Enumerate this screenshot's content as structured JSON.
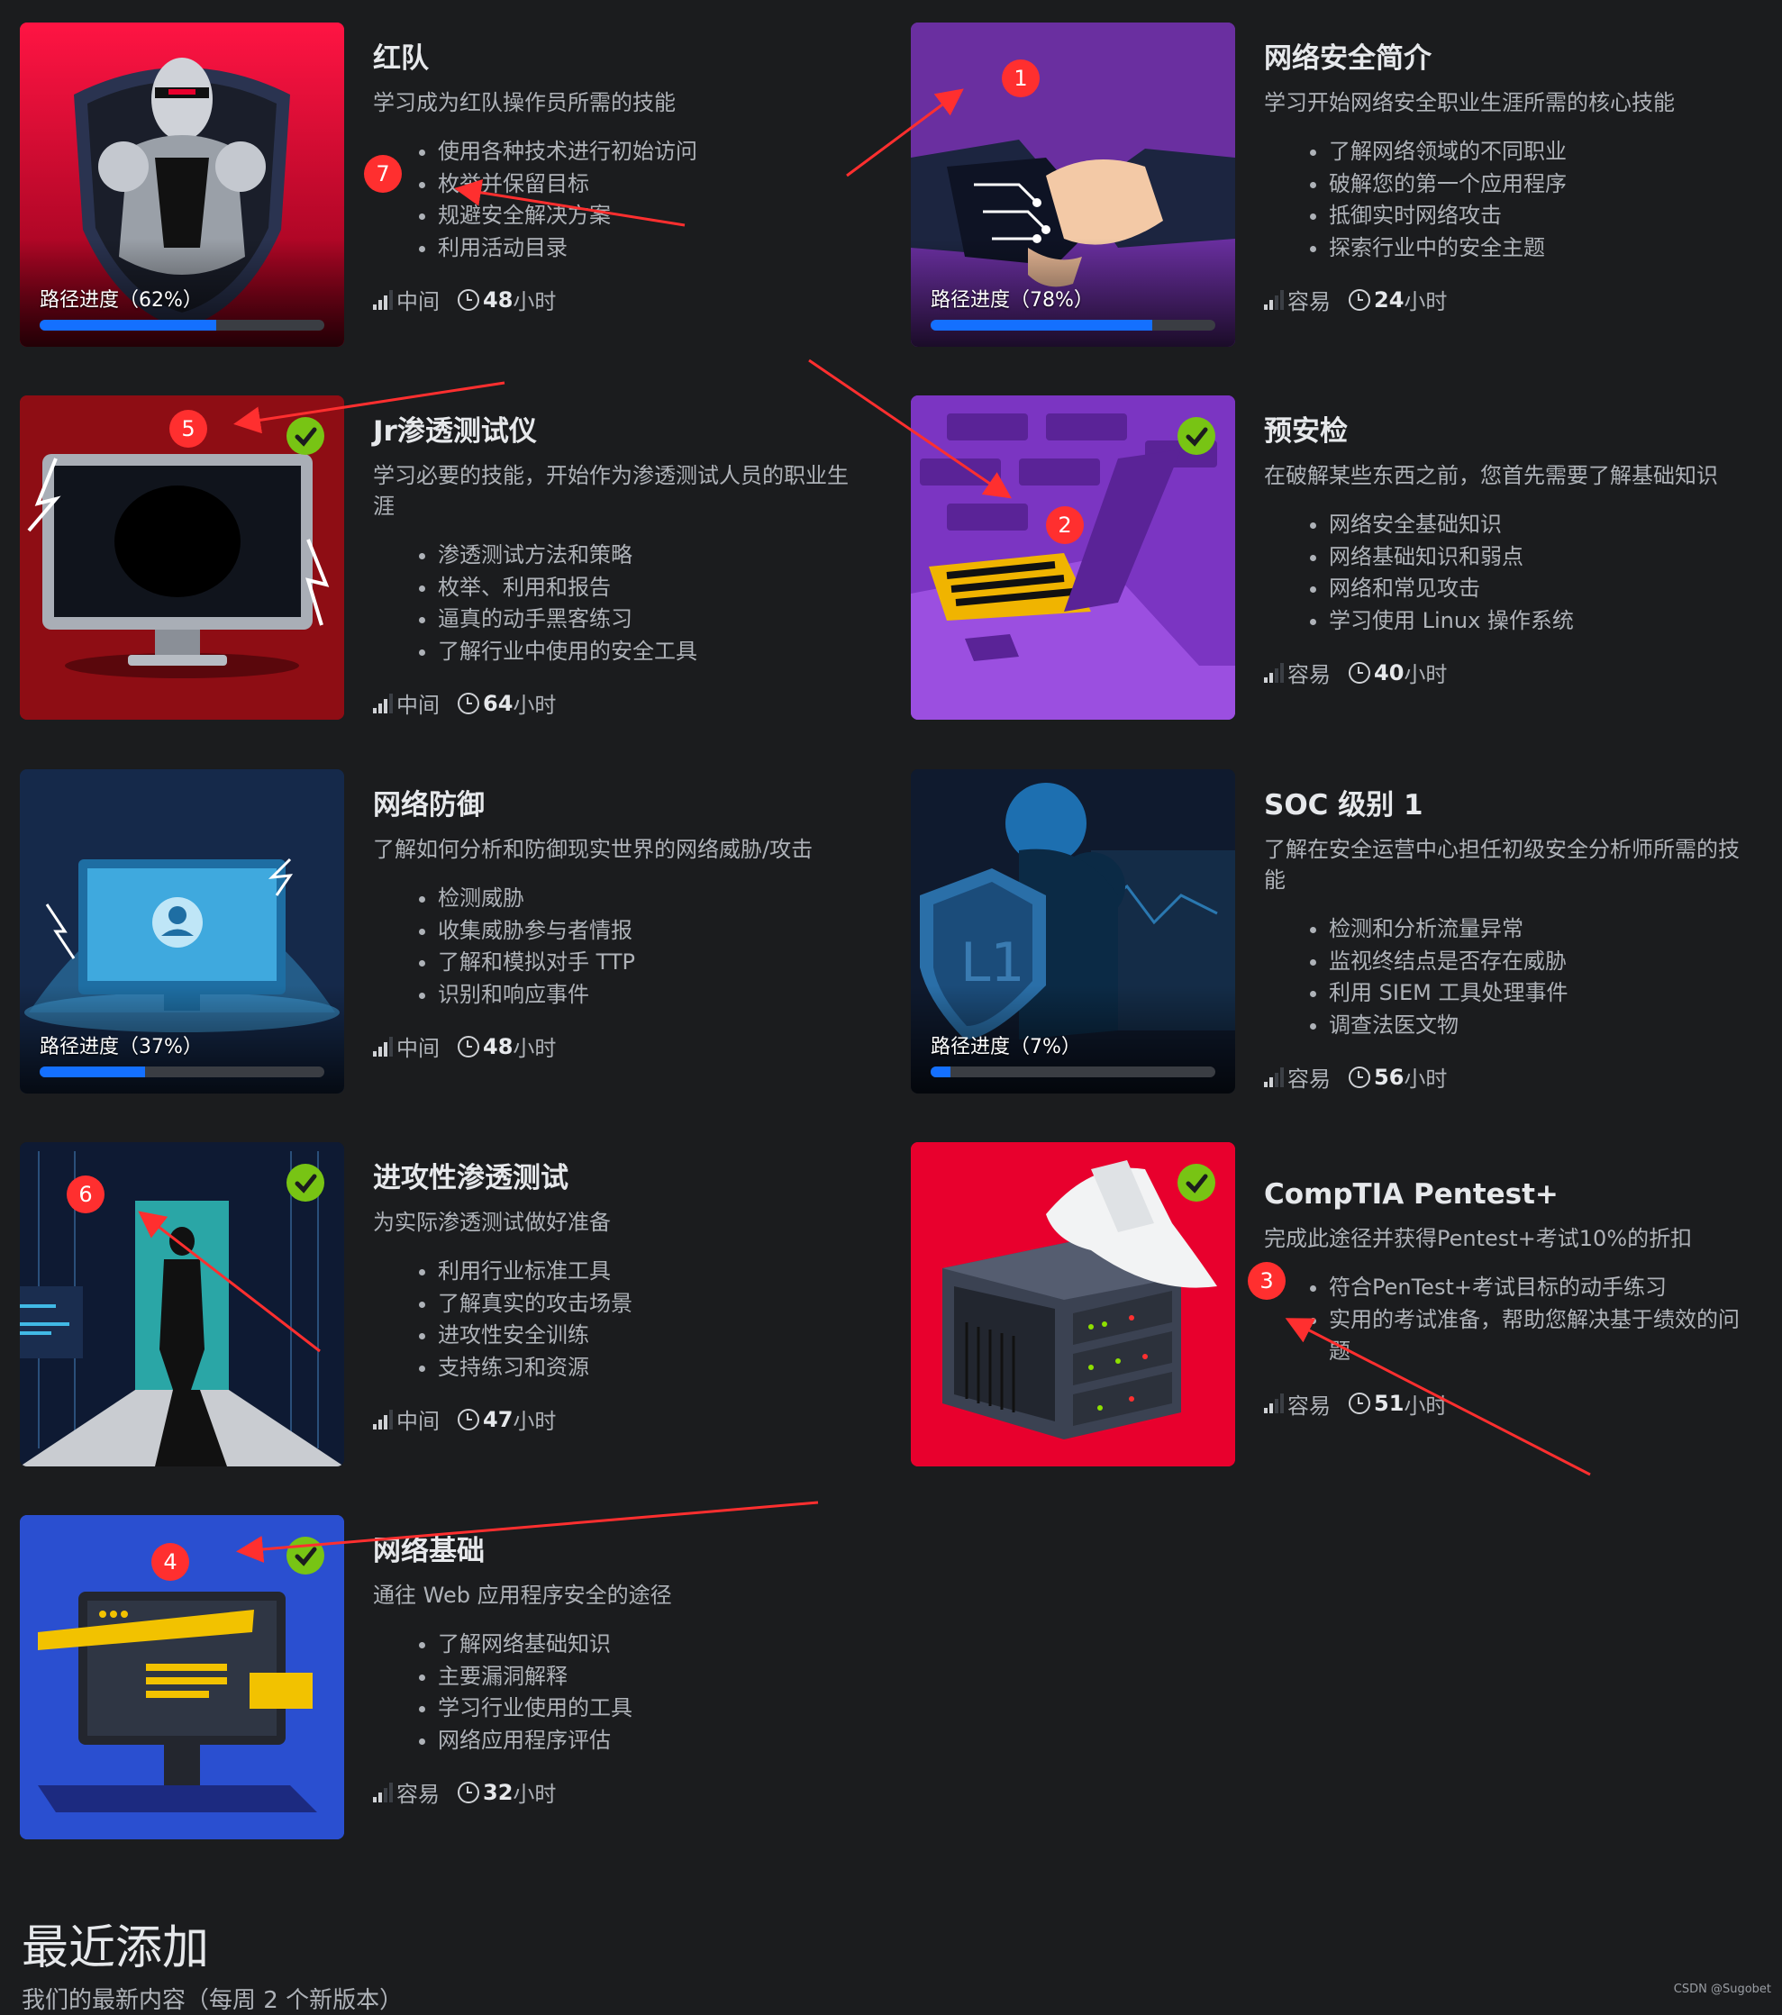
{
  "cards": [
    {
      "title": "红队",
      "desc": "学习成为红队操作员所需的技能",
      "bullets": [
        "使用各种技术进行初始访问",
        "枚举并保留目标",
        "规避安全解决方案",
        "利用活动目录"
      ],
      "difficulty": "中间",
      "hours": "48",
      "hours_unit": "小时",
      "progress_label": "路径进度（62%）",
      "progress": 62,
      "completed": false,
      "image": "knight-shield-illustration",
      "color": "#e8002d"
    },
    {
      "title": "网络安全简介",
      "desc": "学习开始网络安全职业生涯所需的核心技能",
      "bullets": [
        "了解网络领域的不同职业",
        "破解您的第一个应用程序",
        "抵御实时网络攻击",
        "探索行业中的安全主题"
      ],
      "difficulty": "容易",
      "hours": "24",
      "hours_unit": "小时",
      "progress_label": "路径进度（78%）",
      "progress": 78,
      "completed": false,
      "image": "circuit-handshake-illustration",
      "color": "#6a2fa0"
    },
    {
      "title": "Jr渗透测试仪",
      "desc": "学习必要的技能，开始作为渗透测试人员的职业生涯",
      "bullets": [
        "渗透测试方法和策略",
        "枚举、利用和报告",
        "逼真的动手黑客练习",
        "了解行业中使用的安全工具"
      ],
      "difficulty": "中间",
      "hours": "64",
      "hours_unit": "小时",
      "completed": true,
      "image": "monitor-lightning-illustration",
      "color": "#8e0d14"
    },
    {
      "title": "预安检",
      "desc": "在破解某些东西之前，您首先需要了解基础知识",
      "bullets": [
        "网络安全基础知识",
        "网络基础知识和弱点",
        "网络和常见攻击",
        "学习使用 Linux 操作系统"
      ],
      "difficulty": "容易",
      "hours": "40",
      "hours_unit": "小时",
      "completed": true,
      "image": "keyboard-enter-key-illustration",
      "color": "#7b35c2"
    },
    {
      "title": "网络防御",
      "desc": "了解如何分析和防御现实世界的网络威胁/攻击",
      "bullets": [
        "检测威胁",
        "收集威胁参与者情报",
        "了解和模拟对手 TTP",
        "识别和响应事件"
      ],
      "difficulty": "中间",
      "hours": "48",
      "hours_unit": "小时",
      "progress_label": "路径进度（37%）",
      "progress": 37,
      "completed": false,
      "image": "shielded-computer-illustration",
      "color": "#15294a"
    },
    {
      "title": "SOC 级别 1",
      "desc": "了解在安全运营中心担任初级安全分析师所需的技能",
      "bullets": [
        "检测和分析流量异常",
        "监视终结点是否存在威胁",
        "利用 SIEM 工具处理事件",
        "调查法医文物"
      ],
      "difficulty": "容易",
      "hours": "56",
      "hours_unit": "小时",
      "progress_label": "路径进度（7%）",
      "progress": 7,
      "completed": false,
      "image": "robot-l1-shield-illustration",
      "color": "#0f1a2e"
    },
    {
      "title": "进攻性渗透测试",
      "desc": "为实际渗透测试做好准备",
      "bullets": [
        "利用行业标准工具",
        "了解真实的攻击场景",
        "进攻性安全训练",
        "支持练习和资源"
      ],
      "difficulty": "中间",
      "hours": "47",
      "hours_unit": "小时",
      "completed": true,
      "image": "hacker-doorway-illustration",
      "color": "#0e1a33"
    },
    {
      "title": "CompTIA Pentest+",
      "desc": "完成此途径并获得Pentest+考试10%的折扣",
      "bullets": [
        "符合PenTest+考试目标的动手练习",
        "实用的考试准备，帮助您解决基于绩效的问题"
      ],
      "difficulty": "容易",
      "hours": "51",
      "hours_unit": "小时",
      "completed": true,
      "image": "white-hat-server-illustration",
      "color": "#e8002d"
    },
    {
      "title": "网络基础",
      "desc": "通往 Web 应用程序安全的途径",
      "bullets": [
        "了解网络基础知识",
        "主要漏洞解释",
        "学习行业使用的工具",
        "网络应用程序评估"
      ],
      "difficulty": "容易",
      "hours": "32",
      "hours_unit": "小时",
      "completed": true,
      "image": "web-monitor-illustration",
      "color": "#2a4fd0"
    }
  ],
  "annotations": [
    "1",
    "2",
    "3",
    "4",
    "5",
    "6",
    "7"
  ],
  "annotation_color": "#ff2f2f",
  "section": {
    "title": "最近添加",
    "subtitle": "我们的最新内容（每周 2 个新版本）"
  },
  "watermark": "CSDN @Sugobet"
}
